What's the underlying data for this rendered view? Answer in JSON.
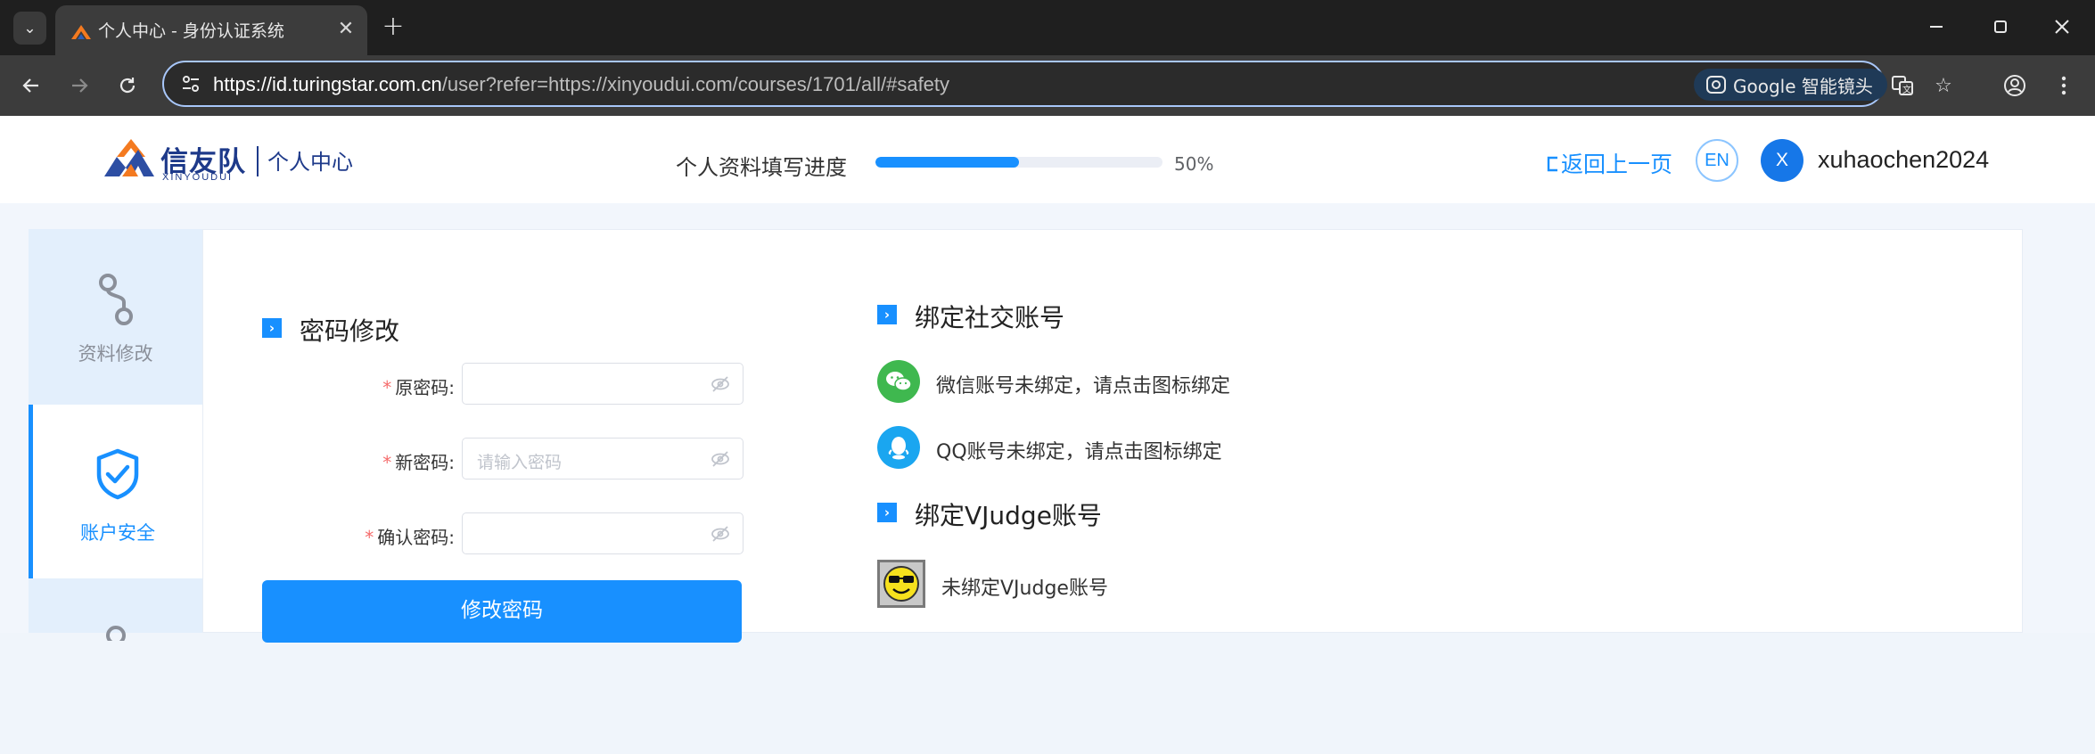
{
  "browser": {
    "tab_title": "个人中心 - 身份认证系统",
    "url_host": "https://id.turingstar.com.cn",
    "url_rest": "/user?refer=https://xinyoudui.com/courses/1701/all/#safety",
    "lens_label": "Google 智能镜头"
  },
  "header": {
    "brand_name": "信友队",
    "brand_sub": "XINYOUDUI",
    "center_title": "个人中心",
    "progress_label": "个人资料填写进度",
    "progress_value": 0.5,
    "progress_text": "50%",
    "back_label": "返回上一页",
    "lang_label": "EN",
    "avatar_letter": "X",
    "username": "xuhaochen2024"
  },
  "sidebar": {
    "items": [
      {
        "label": "资料修改",
        "icon": "profile-edit-icon",
        "active": false
      },
      {
        "label": "账户安全",
        "icon": "shield-check-icon",
        "active": true
      }
    ]
  },
  "password_section": {
    "title": "密码修改",
    "fields": [
      {
        "label": "原密码:",
        "placeholder": ""
      },
      {
        "label": "新密码:",
        "placeholder": "请输入密码"
      },
      {
        "label": "确认密码:",
        "placeholder": ""
      }
    ],
    "submit_label": "修改密码"
  },
  "social_section": {
    "title": "绑定社交账号",
    "wechat_text": "微信账号未绑定，请点击图标绑定",
    "qq_text": "QQ账号未绑定，请点击图标绑定"
  },
  "vjudge_section": {
    "title": "绑定VJudge账号",
    "status_text": "未绑定VJudge账号"
  },
  "colors": {
    "primary": "#1890ff",
    "brand": "#1e3a8a",
    "wechat": "#3fb84f",
    "qq": "#1aa6f0",
    "required": "#f56c6c"
  }
}
